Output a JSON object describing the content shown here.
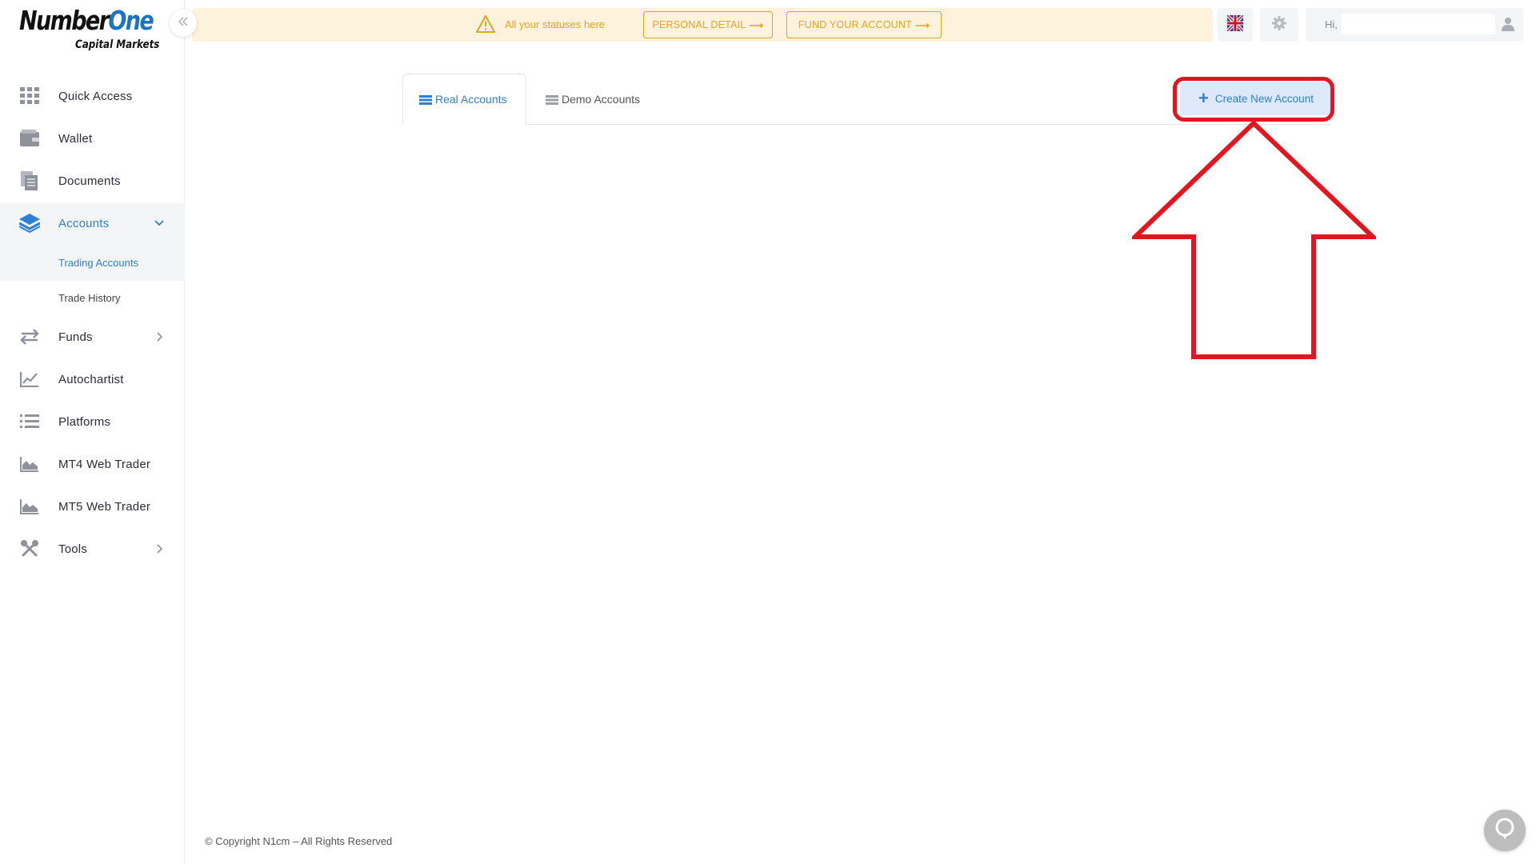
{
  "logo": {
    "brand_part1": "Number",
    "brand_part2": "One",
    "sub": "Capital Markets"
  },
  "sidebar": {
    "items": [
      {
        "label": "Quick Access",
        "icon": "grid-icon"
      },
      {
        "label": "Wallet",
        "icon": "wallet-icon"
      },
      {
        "label": "Documents",
        "icon": "documents-icon"
      },
      {
        "label": "Accounts",
        "icon": "layers-icon",
        "active": true,
        "expanded": true
      },
      {
        "label": "Funds",
        "icon": "transfer-icon"
      },
      {
        "label": "Autochartist",
        "icon": "chart-line-icon"
      },
      {
        "label": "Platforms",
        "icon": "list-icon"
      },
      {
        "label": "MT4 Web Trader",
        "icon": "area-chart-icon"
      },
      {
        "label": "MT5 Web Trader",
        "icon": "area-chart-icon"
      },
      {
        "label": "Tools",
        "icon": "tools-icon"
      }
    ],
    "accounts_sub": [
      {
        "label": "Trading Accounts",
        "active": true
      },
      {
        "label": "Trade History"
      }
    ]
  },
  "status_bar": {
    "message": "All your statuses here",
    "personal_detail": "PERSONAL DETAIL",
    "fund_account": "FUND YOUR ACCOUNT"
  },
  "user": {
    "greeting": "Hi,"
  },
  "tabs": [
    {
      "label": "Real Accounts",
      "active": true
    },
    {
      "label": "Demo Accounts"
    }
  ],
  "create_button": "Create New Account",
  "footer": "© Copyright N1cm – All Rights Reserved",
  "colors": {
    "accent": "#2e7fd6",
    "warning": "#e9a21b",
    "highlight": "#e5141e",
    "status_bg": "#fdf3dc"
  }
}
